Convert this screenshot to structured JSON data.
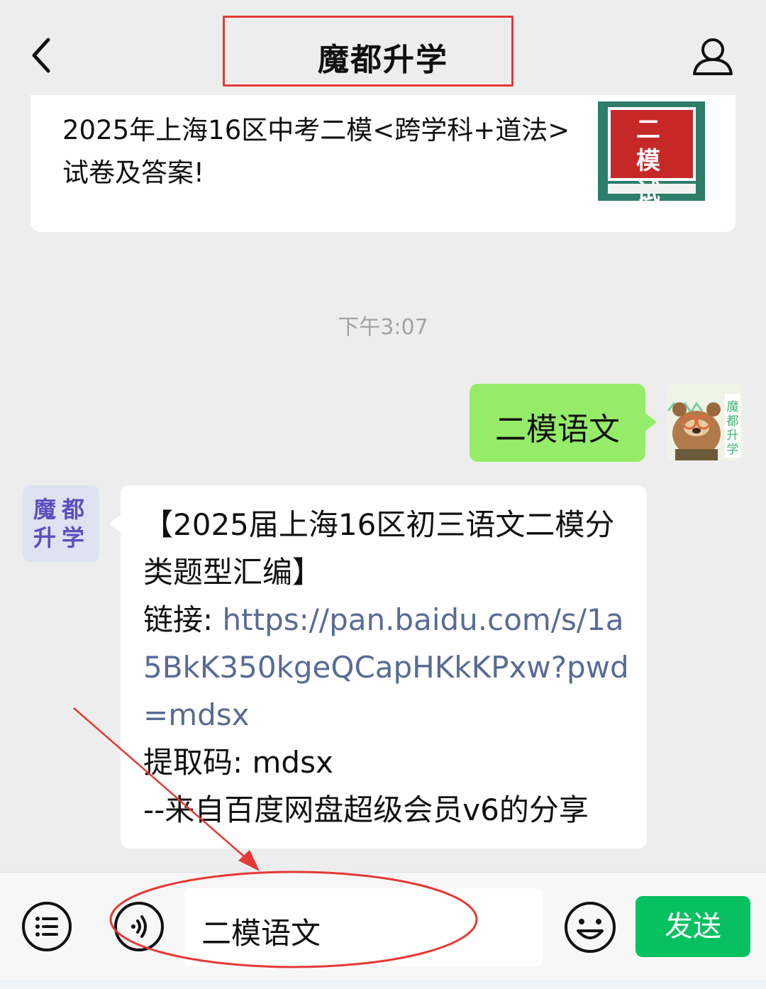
{
  "header": {
    "title": "魔都升学",
    "back_icon": "chevron-left-icon",
    "profile_icon": "person-icon"
  },
  "article": {
    "title": "2025年上海16区中考二模<跨学科+道法>试卷及答案!",
    "thumbnail": {
      "text": "二 模 试 卷",
      "bg_color": "#2e7d6b",
      "panel_color": "#c62828"
    }
  },
  "timestamp": "下午3:07",
  "messages": {
    "sent": {
      "text": "二模语文",
      "bubble_color": "#95ec69",
      "avatar_label": "魔都升学"
    },
    "received": {
      "avatar_label": "魔都升学",
      "heading": "【2025届上海16区初三语文二模分类题型汇编】",
      "link_label": "链接: ",
      "link_url": "https://pan.baidu.com/s/1a5BkK350kgeQCapHKkKPxw?pwd=mdsx",
      "code_line": "提取码: mdsx",
      "source_line": "--来自百度网盘超级会员v6的分享",
      "link_color": "#576b95"
    }
  },
  "input_bar": {
    "menu_icon": "list-menu-icon",
    "voice_icon": "voice-icon",
    "input_value": "二模语文",
    "emoji_icon": "smiley-icon",
    "send_label": "发送",
    "send_color": "#07c160"
  },
  "annotation": {
    "color": "#e53935"
  }
}
